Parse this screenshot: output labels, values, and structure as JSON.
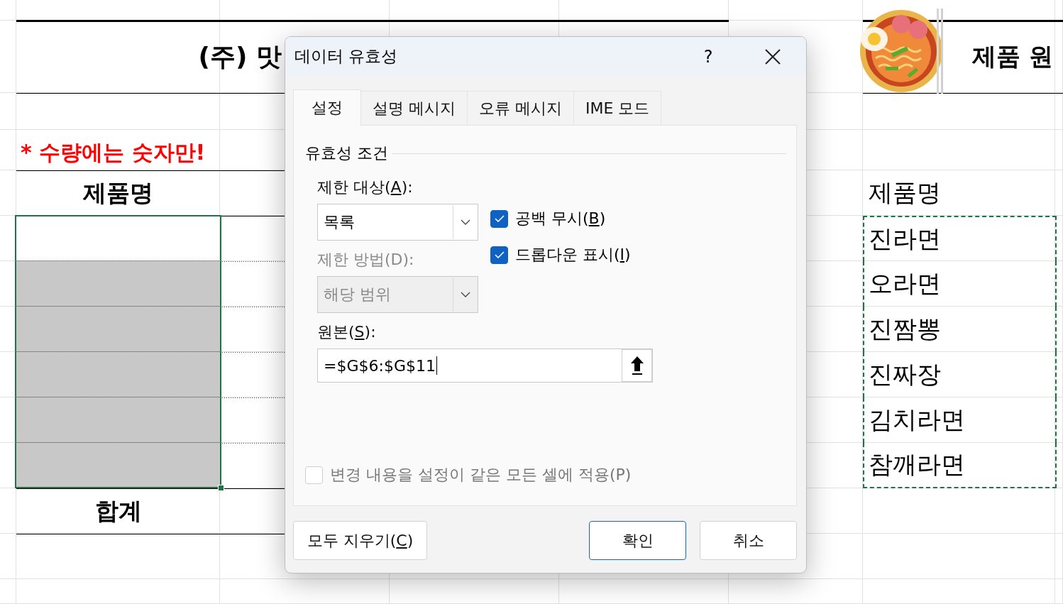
{
  "sheet": {
    "title": "(주) 맛",
    "note": "* 수량에는 숫자만!",
    "left_header": "제품명",
    "input_rows": [
      {
        "shaded": false
      },
      {
        "shaded": true
      },
      {
        "shaded": true
      },
      {
        "shaded": true
      },
      {
        "shaded": true
      },
      {
        "shaded": true
      }
    ],
    "total_label": "합계",
    "right_title": "제품 원",
    "right_header": "제품명",
    "products": [
      "진라면",
      "오라면",
      "진짬뽕",
      "진짜장",
      "김치라면",
      "참깨라면"
    ]
  },
  "dialog": {
    "title": "데이터 유효성",
    "help": "?",
    "tabs": [
      {
        "label": "설정",
        "selected": true
      },
      {
        "label": "설명 메시지",
        "selected": false
      },
      {
        "label": "오류 메시지",
        "selected": false
      },
      {
        "label": "IME 모드",
        "selected": false
      }
    ],
    "group_label": "유효성 조건",
    "allow": {
      "label": {
        "pre": "제한 대상(",
        "key": "A",
        "post": "):"
      },
      "value": "목록",
      "disabled": false
    },
    "data": {
      "label": {
        "pre": "제한 방법(D):"
      },
      "value": "해당 범위",
      "disabled": true
    },
    "checkboxes": [
      {
        "label": {
          "pre": "공백 무시(",
          "key": "B",
          "post": ")"
        },
        "checked": true,
        "disabled": false
      },
      {
        "label": {
          "pre": "드롭다운 표시(",
          "key": "I",
          "post": ")"
        },
        "checked": true,
        "disabled": false
      }
    ],
    "source": {
      "label": {
        "pre": "원본(",
        "key": "S",
        "post": "):"
      },
      "value": "=$G$6:$G$11"
    },
    "apply_all": {
      "label": {
        "pre": "변경 내용을 설정이 같은 모든 셀에 적용(P)"
      },
      "checked": false,
      "disabled": true
    },
    "buttons": [
      {
        "label": {
          "pre": "모두 지우기(",
          "key": "C",
          "post": ")"
        },
        "default": false
      },
      {
        "label": {
          "pre": "확인"
        },
        "default": true
      },
      {
        "label": {
          "pre": "취소"
        },
        "default": false
      }
    ]
  }
}
